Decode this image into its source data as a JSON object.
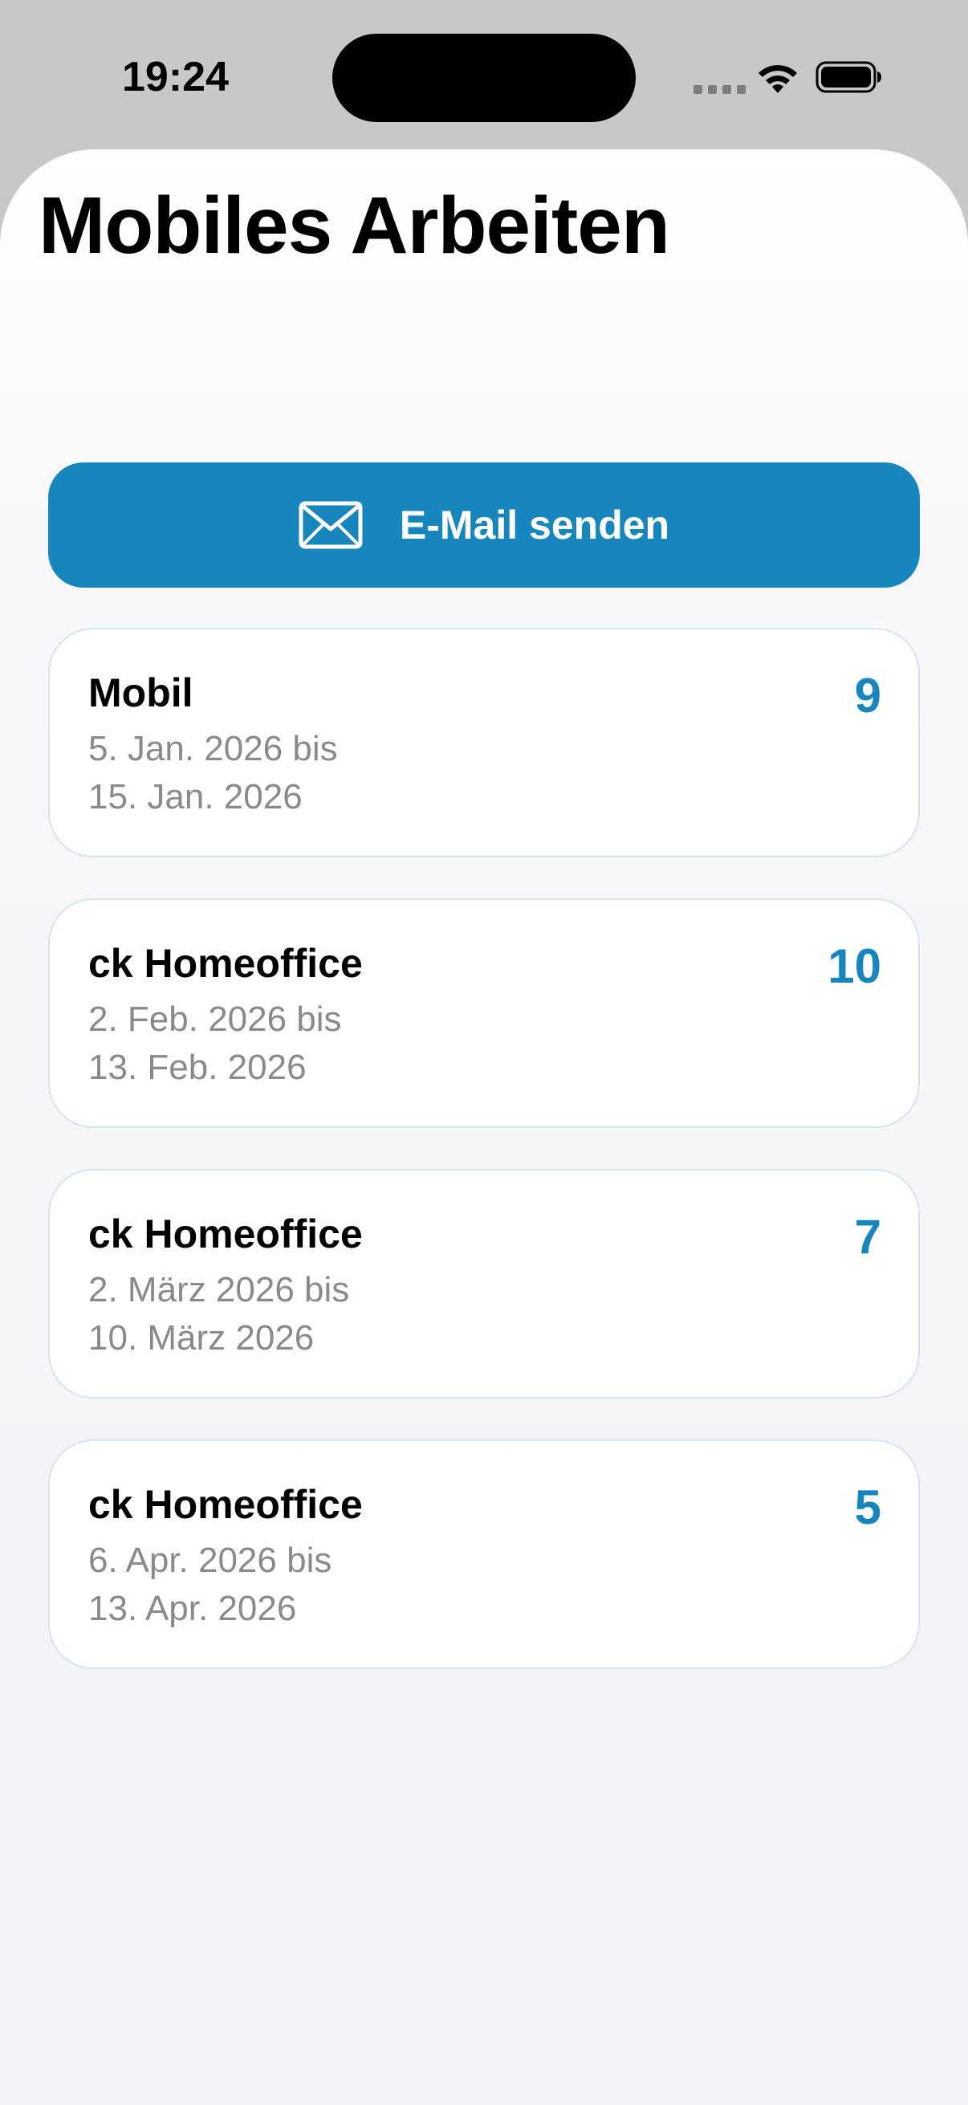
{
  "status_bar": {
    "time": "19:24"
  },
  "header": {
    "title": "Mobiles Arbeiten"
  },
  "actions": {
    "email_label": "E-Mail senden",
    "email_icon": "envelope-icon"
  },
  "colors": {
    "accent": "#1686bd",
    "secondary_text": "#8a8a8e",
    "card_border": "#d6e4f0"
  },
  "entries": [
    {
      "title": "Mobil",
      "range_start": "5. Jan. 2026 bis",
      "range_end": "15. Jan. 2026",
      "days": "9"
    },
    {
      "title": "ck Homeoffice",
      "range_start": "2. Feb. 2026 bis",
      "range_end": "13. Feb. 2026",
      "days": "10"
    },
    {
      "title": "ck Homeoffice",
      "range_start": "2. März 2026 bis",
      "range_end": "10. März 2026",
      "days": "7"
    },
    {
      "title": "ck Homeoffice",
      "range_start": "6. Apr. 2026 bis",
      "range_end": "13. Apr. 2026",
      "days": "5"
    }
  ]
}
